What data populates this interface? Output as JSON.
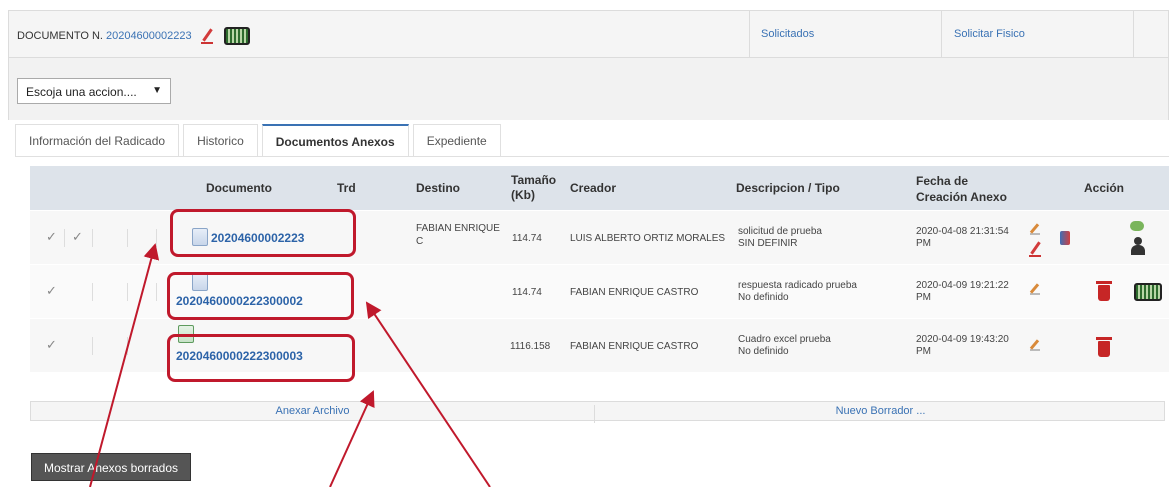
{
  "header": {
    "doc_label": "DOCUMENTO N.",
    "doc_number": "20204600002223",
    "links": [
      "Solicitados",
      "Solicitar Fisico"
    ]
  },
  "actions": {
    "select_value": "Escoja una accion....",
    "caret": "▼"
  },
  "tabs": [
    {
      "label": "Información del Radicado",
      "active": false
    },
    {
      "label": "Historico",
      "active": false
    },
    {
      "label": "Documentos Anexos",
      "active": true
    },
    {
      "label": "Expediente",
      "active": false
    }
  ],
  "table": {
    "headers": {
      "documento": "Documento",
      "trd": "Trd",
      "destino": "Destino",
      "tamano_1": "Tamaño",
      "tamano_2": "(Kb)",
      "creador": "Creador",
      "descripcion": "Descripcion / Tipo",
      "fecha_1": "Fecha de",
      "fecha_2": "Creación Anexo",
      "accion": "Acción"
    },
    "rows": [
      {
        "documento": "20204600002223",
        "destino_1": "FABIAN ENRIQUE",
        "destino_2": "C",
        "tamano": "114.74",
        "creador": "LUIS ALBERTO ORTIZ MORALES",
        "desc_1": "solicitud de prueba",
        "desc_2": "SIN DEFINIR",
        "fecha_1": "2020-04-08 21:31:54",
        "fecha_2": "PM"
      },
      {
        "documento": "2020460000222300002",
        "destino_1": "",
        "destino_2": "",
        "tamano": "114.74",
        "creador": "FABIAN ENRIQUE CASTRO",
        "desc_1": "respuesta radicado prueba",
        "desc_2": "No definido",
        "fecha_1": "2020-04-09 19:21:22",
        "fecha_2": "PM"
      },
      {
        "documento": "2020460000222300003",
        "destino_1": "",
        "destino_2": "",
        "tamano": "1116.158",
        "creador": "FABIAN ENRIQUE CASTRO",
        "desc_1": "Cuadro excel prueba",
        "desc_2": "No definido",
        "fecha_1": "2020-04-09 19:43:20",
        "fecha_2": "PM"
      }
    ]
  },
  "footer": {
    "anexar": "Anexar Archivo",
    "borrador": "Nuevo Borrador ..."
  },
  "button_borrados": "Mostrar Anexos borrados",
  "check_glyph": "✓",
  "colors": {
    "highlight": "#c0192c",
    "link": "#3a72b4",
    "header_bg": "#dde3ea"
  }
}
